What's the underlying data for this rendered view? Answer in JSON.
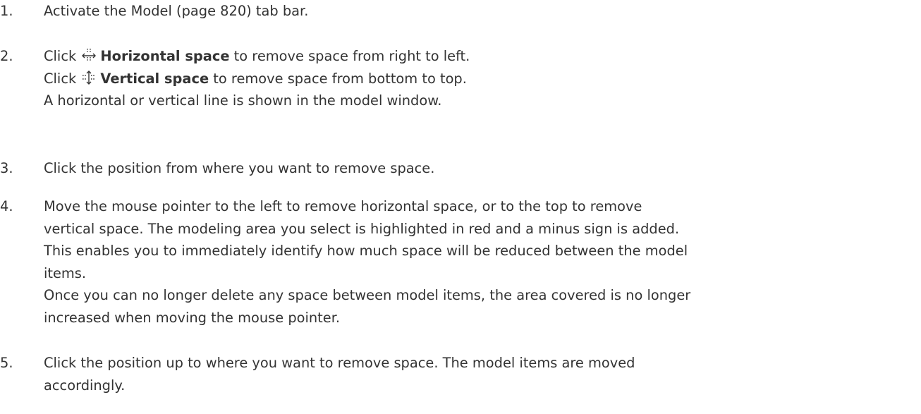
{
  "steps": [
    {
      "number": "1.",
      "text": "Activate the Model (page 820) tab bar."
    },
    {
      "number": "2.",
      "line1_prefix": "Click",
      "line1_bold": "Horizontal space",
      "line1_suffix": "to remove space from right to left.",
      "line1_icon": "horizontal-space-icon",
      "line2_prefix": "Click",
      "line2_bold": "Vertical space",
      "line2_suffix": "to remove space from bottom to top.",
      "line2_icon": "vertical-space-icon",
      "line3": "A horizontal or vertical line is shown in the model window."
    },
    {
      "number": "3.",
      "text": "Click the position from where you want to remove space."
    },
    {
      "number": "4.",
      "lines": [
        "Move the mouse pointer to the left to remove horizontal space, or to the top to remove",
        "vertical space. The modeling area you select is highlighted in red and a minus sign is added.",
        "This enables you to immediately identify how much space will be reduced between the model",
        "items.",
        "Once you can no longer delete any space between model items, the area covered is no longer",
        "increased when moving the mouse pointer."
      ]
    },
    {
      "number": "5.",
      "lines": [
        "Click the position up to where you want to remove space. The model items are moved",
        "accordingly."
      ]
    }
  ],
  "colors": {
    "text": "#333333",
    "background": "#ffffff"
  }
}
